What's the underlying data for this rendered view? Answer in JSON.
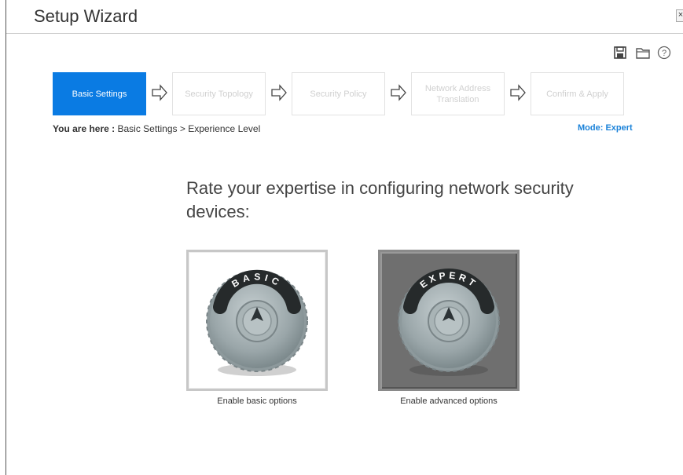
{
  "window": {
    "title": "Setup Wizard",
    "close_glyph": "×"
  },
  "toolbar": {
    "icons": [
      "save-icon",
      "folder-icon",
      "help-icon"
    ],
    "help_glyph": "?"
  },
  "steps": [
    {
      "label": "Basic Settings",
      "active": true
    },
    {
      "label": "Security Topology",
      "active": false
    },
    {
      "label": "Security Policy",
      "active": false
    },
    {
      "label": "Network Address Translation",
      "active": false
    },
    {
      "label": "Confirm & Apply",
      "active": false
    }
  ],
  "breadcrumb": {
    "prefix": "You are here :",
    "path": "Basic Settings > Experience Level"
  },
  "mode": {
    "label": "Mode: Expert"
  },
  "prompt": {
    "question": "Rate your expertise in configuring network security devices:"
  },
  "options": {
    "basic": {
      "dial_label": "BASIC",
      "caption": "Enable basic options"
    },
    "expert": {
      "dial_label": "EXPERT",
      "caption": "Enable advanced options"
    }
  },
  "colors": {
    "accent": "#0a7be3",
    "mode_text": "#1a82d9",
    "expert_bg": "#6f6f6f",
    "dial": "#9aa6a9"
  }
}
